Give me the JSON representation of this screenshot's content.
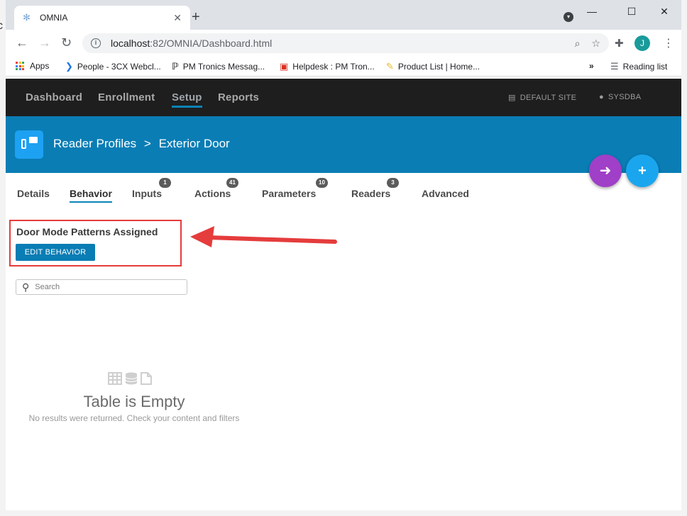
{
  "browser": {
    "tab_title": "OMNIA",
    "url_host": "localhost",
    "url_path": ":82/OMNIA/Dashboard.html",
    "avatar_letter": "J",
    "bookmarks": [
      {
        "label": "Apps",
        "icon": "apps-grid-icon"
      },
      {
        "label": "People - 3CX Webcl...",
        "icon": "chevron-right-icon"
      },
      {
        "label": "PM Tronics Messag...",
        "icon": "pm-logo-icon"
      },
      {
        "label": "Helpdesk : PM Tron...",
        "icon": "helpdesk-icon"
      },
      {
        "label": "Product List | Home...",
        "icon": "note-icon"
      }
    ],
    "overflow_label": "»",
    "reading_list_label": "Reading list"
  },
  "app": {
    "nav": {
      "items": [
        "Dashboard",
        "Enrollment",
        "Setup",
        "Reports"
      ],
      "active": "Setup",
      "site_label": "DEFAULT SITE",
      "user_label": "SYSDBA"
    },
    "header": {
      "breadcrumb_parent": "Reader Profiles",
      "separator": ">",
      "breadcrumb_current": "Exterior Door",
      "back_button_color": "#a03fc7",
      "add_button_color": "#1aa6ee"
    },
    "tabs": [
      {
        "label": "Details",
        "badge": null
      },
      {
        "label": "Behavior",
        "badge": null
      },
      {
        "label": "Inputs",
        "badge": "1"
      },
      {
        "label": "Actions",
        "badge": "41"
      },
      {
        "label": "Parameters",
        "badge": "10"
      },
      {
        "label": "Readers",
        "badge": "3"
      },
      {
        "label": "Advanced",
        "badge": null
      }
    ],
    "active_tab": "Behavior",
    "section_title": "Door Mode Patterns Assigned",
    "edit_button_label": "EDIT BEHAVIOR",
    "search_placeholder": "Search",
    "empty_title": "Table is Empty",
    "empty_subtitle": "No results were returned. Check your content and filters"
  },
  "colors": {
    "nav_bg": "#1e1e1e",
    "header_bg": "#0a7db5",
    "accent": "#0b84b8",
    "annotation_red": "#e53c3c"
  }
}
